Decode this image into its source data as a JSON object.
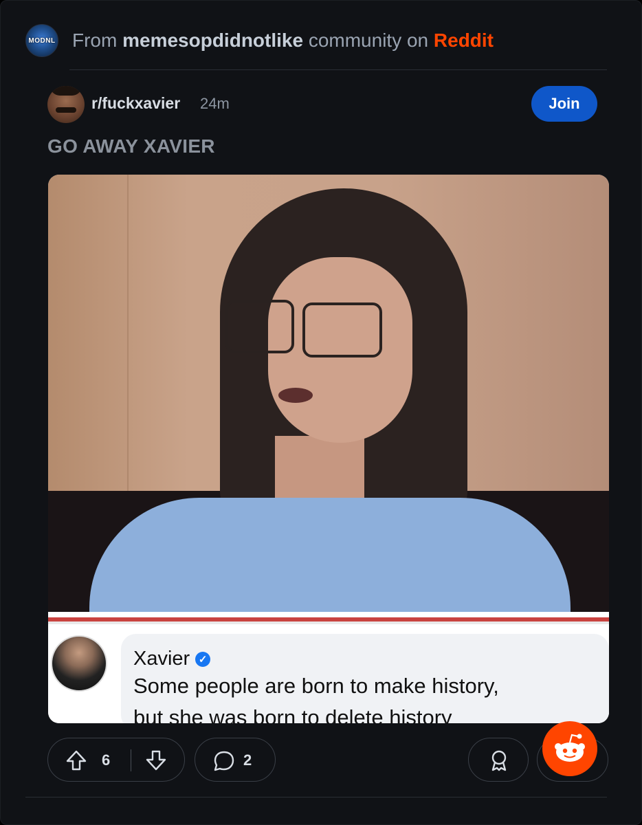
{
  "source": {
    "prefix": "From",
    "community": "memesopdidnotlike",
    "middle": "community on",
    "platform": "Reddit",
    "logo_text": "MODNL"
  },
  "post": {
    "subreddit": "r/fuckxavier",
    "time": "24m",
    "join_label": "Join",
    "title": "GO AWAY XAVIER"
  },
  "embedded_tweet": {
    "name": "Xavier",
    "line1": "Some people are born to make history,",
    "line2": "but she was born to delete history"
  },
  "actions": {
    "upvotes": "6",
    "comments": "2"
  },
  "colors": {
    "reddit": "#ff4500",
    "join": "#0f57c9",
    "verified": "#1877f2"
  }
}
